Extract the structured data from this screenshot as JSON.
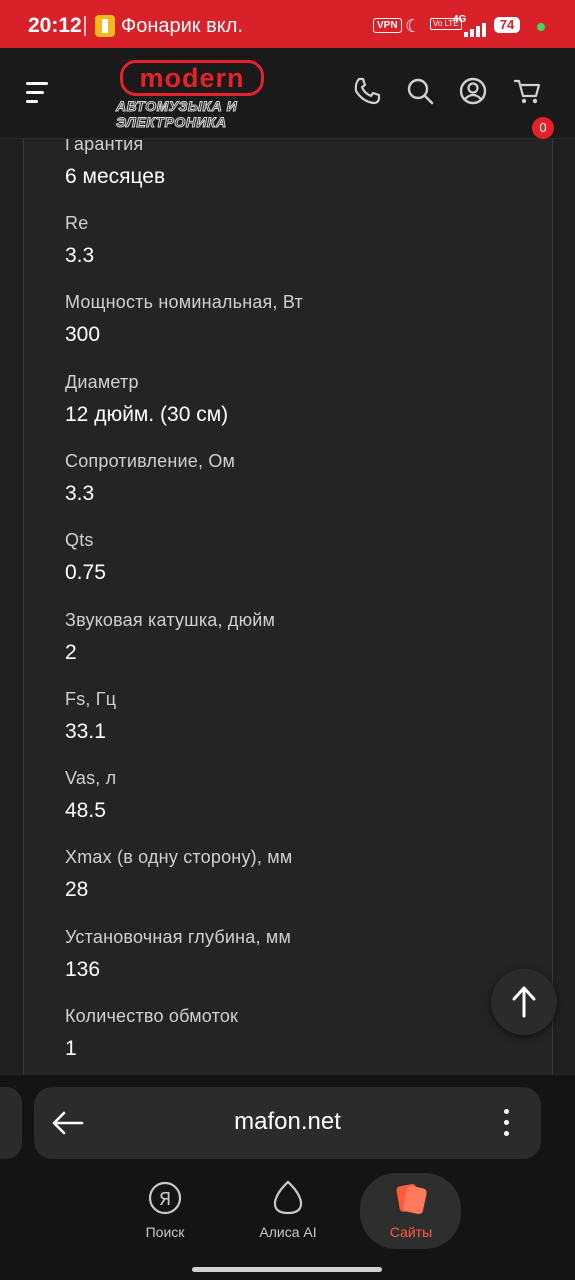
{
  "status_bar": {
    "time": "20:12",
    "notification": "Фонарик вкл.",
    "vpn": "VPN",
    "volte": "Vo LTE",
    "network": "4G",
    "battery": "74"
  },
  "header": {
    "logo_word": "modern",
    "logo_line1": "АВТОМУЗЫКА И",
    "logo_line2": "ЭЛЕКТРОНИКА",
    "icons": [
      "menu-icon",
      "phone-icon",
      "search-icon",
      "account-icon",
      "cart-icon"
    ],
    "cart_count": "0",
    "accent_color": "#e5222b"
  },
  "specs": [
    {
      "label": "Гарантия",
      "value": "6 месяцев"
    },
    {
      "label": "Re",
      "value": "3.3"
    },
    {
      "label": "Мощность номинальная, Вт",
      "value": "300"
    },
    {
      "label": "Диаметр",
      "value": "12 дюйм. (30 см)"
    },
    {
      "label": "Сопротивление, Ом",
      "value": "3.3"
    },
    {
      "label": "Qts",
      "value": "0.75"
    },
    {
      "label": "Звуковая катушка, дюйм",
      "value": "2"
    },
    {
      "label": "Fs, Гц",
      "value": "33.1"
    },
    {
      "label": "Vas, л",
      "value": "48.5"
    },
    {
      "label": "Xmax (в одну сторону), мм",
      "value": "28"
    },
    {
      "label": "Установочная глубина, мм",
      "value": "136"
    },
    {
      "label": "Количество обмоток",
      "value": "1"
    }
  ],
  "browser": {
    "url": "mafon.net",
    "tabs": [
      {
        "label": "Поиск",
        "icon": "yandex-search-icon",
        "active": false
      },
      {
        "label": "Алиса AI",
        "icon": "alice-icon",
        "active": false
      },
      {
        "label": "Сайты",
        "icon": "sites-icon",
        "active": true
      }
    ],
    "active_color": "#ff5a3c"
  }
}
